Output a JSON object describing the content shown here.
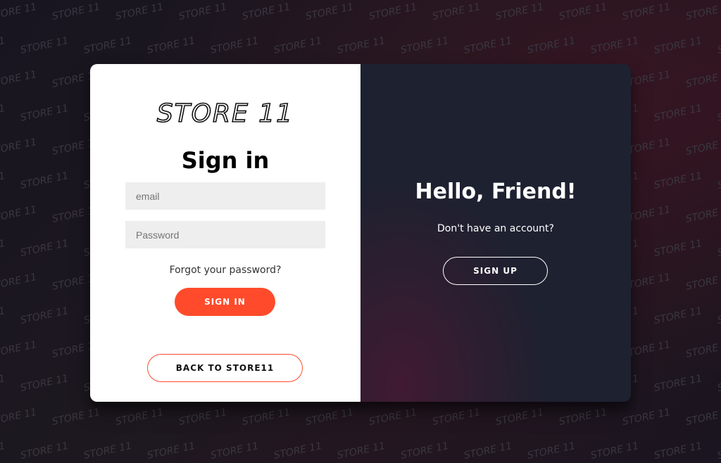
{
  "background": {
    "pattern_text": "STORE 11",
    "base_color": "#1b1720",
    "pattern_color": "#3a3740"
  },
  "login": {
    "logo_text": "STORE 11",
    "title": "Sign in",
    "email_placeholder": "email",
    "email_value": "",
    "password_placeholder": "Password",
    "password_value": "",
    "forgot_label": "Forgot your password?",
    "signin_label": "SIGN IN",
    "back_label": "BACK TO STORE11"
  },
  "overlay": {
    "title": "Hello, Friend!",
    "subtitle": "Don't have an account?",
    "signup_label": "SIGN UP"
  },
  "colors": {
    "accent": "#ff4b2b",
    "panel_dark": "#1e2130",
    "panel_light": "#ffffff",
    "input_bg": "#eeeeee"
  }
}
